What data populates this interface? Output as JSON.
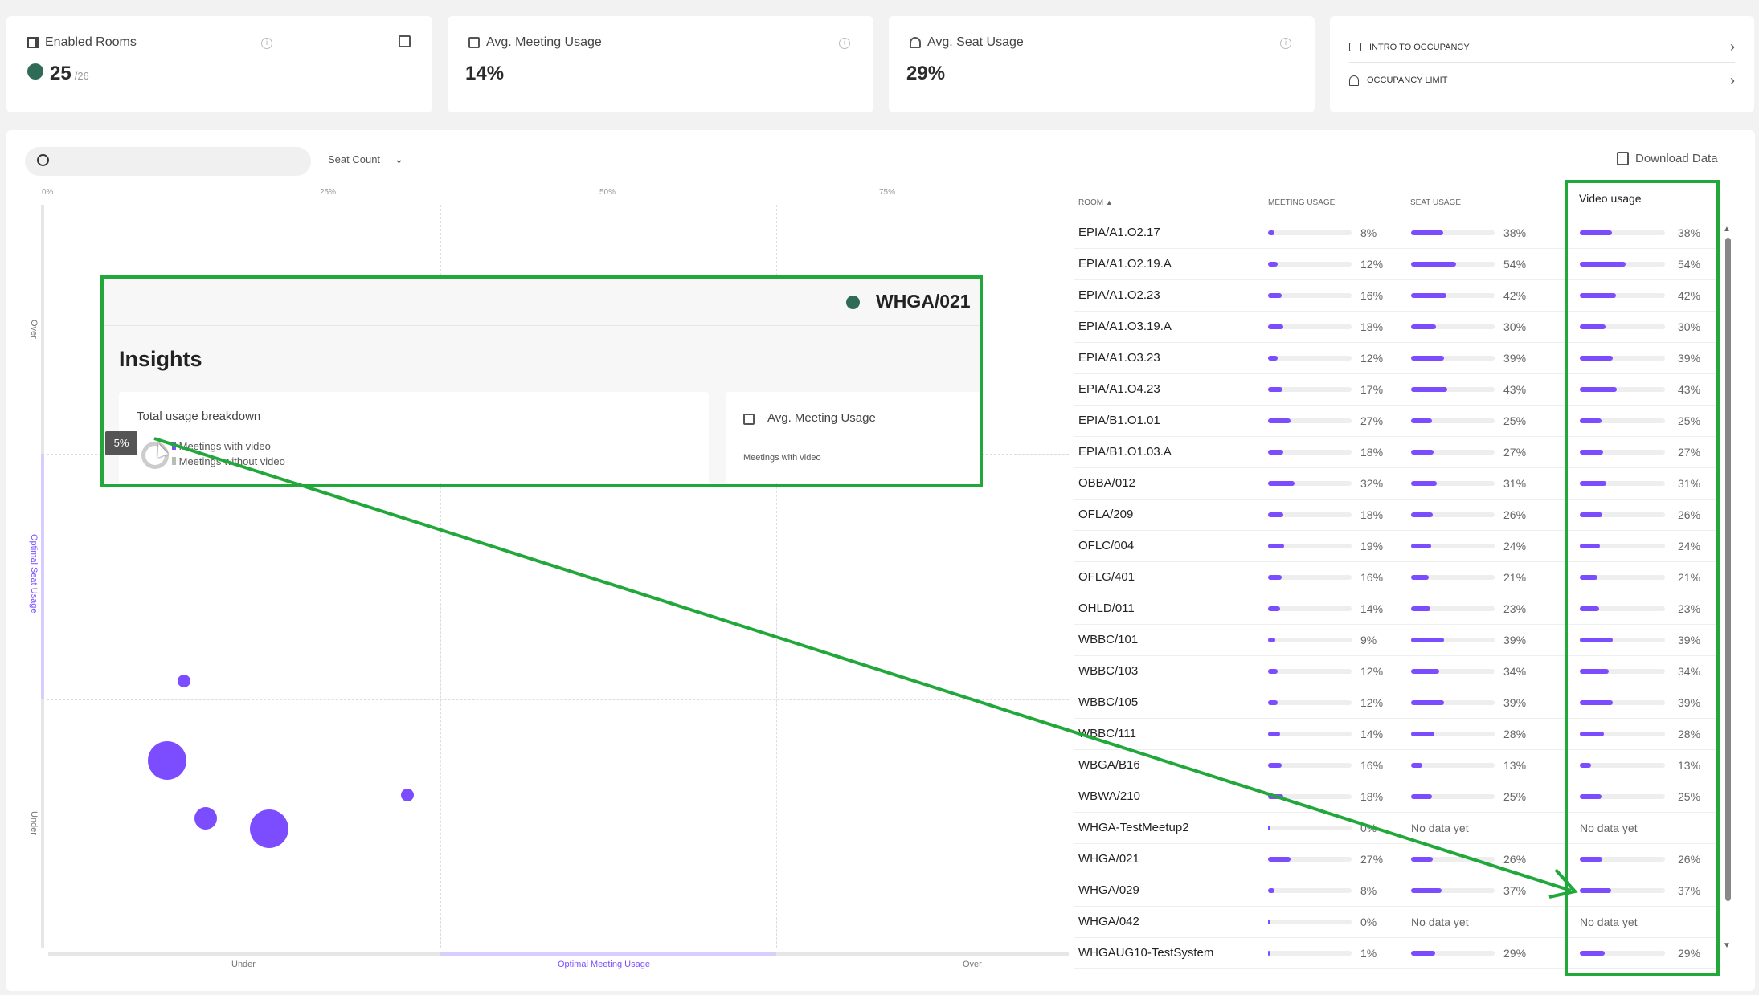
{
  "kpis": {
    "enabled_rooms": {
      "label": "Enabled Rooms",
      "value": "25",
      "sub": "/26"
    },
    "avg_meeting_usage": {
      "label": "Avg. Meeting Usage",
      "value": "14%"
    },
    "avg_seat_usage": {
      "label": "Avg. Seat Usage",
      "value": "29%"
    },
    "links": [
      {
        "label": "INTRO TO OCCUPANCY"
      },
      {
        "label": "OCCUPANCY LIMIT"
      }
    ]
  },
  "toolbar": {
    "search_placeholder": "",
    "seat_count_label": "Seat Count",
    "download_label": "Download Data"
  },
  "chart": {
    "x_ticks": [
      "0%",
      "25%",
      "50%",
      "75%"
    ],
    "y_axis_labels": {
      "over": "Over",
      "optimal": "Optimal Seat Usage",
      "under": "Under"
    },
    "x_axis_labels": {
      "under": "Under",
      "optimal": "Optimal Meeting Usage",
      "over": "Over"
    }
  },
  "insights": {
    "room_name": "WHGA/021",
    "title": "Insights",
    "breakdown_title": "Total usage breakdown",
    "tooltip": "5%",
    "legend_with_video": "Meetings with video",
    "legend_without_video": "Meetings without video",
    "avg_meeting_label": "Avg. Meeting Usage",
    "avg_meeting_sub": "Meetings with video"
  },
  "table": {
    "headers": {
      "room": "ROOM",
      "meeting": "MEETING USAGE",
      "seat": "SEAT USAGE",
      "video": "Video usage"
    },
    "no_data": "No data yet",
    "rows": [
      {
        "room": "EPIA/A1.O2.17",
        "meeting": 8,
        "seat": 38,
        "video": 38
      },
      {
        "room": "EPIA/A1.O2.19.A",
        "meeting": 12,
        "seat": 54,
        "video": 54
      },
      {
        "room": "EPIA/A1.O2.23",
        "meeting": 16,
        "seat": 42,
        "video": 42
      },
      {
        "room": "EPIA/A1.O3.19.A",
        "meeting": 18,
        "seat": 30,
        "video": 30
      },
      {
        "room": "EPIA/A1.O3.23",
        "meeting": 12,
        "seat": 39,
        "video": 39
      },
      {
        "room": "EPIA/A1.O4.23",
        "meeting": 17,
        "seat": 43,
        "video": 43
      },
      {
        "room": "EPIA/B1.O1.01",
        "meeting": 27,
        "seat": 25,
        "video": 25
      },
      {
        "room": "EPIA/B1.O1.03.A",
        "meeting": 18,
        "seat": 27,
        "video": 27
      },
      {
        "room": "OBBA/012",
        "meeting": 32,
        "seat": 31,
        "video": 31
      },
      {
        "room": "OFLA/209",
        "meeting": 18,
        "seat": 26,
        "video": 26
      },
      {
        "room": "OFLC/004",
        "meeting": 19,
        "seat": 24,
        "video": 24
      },
      {
        "room": "OFLG/401",
        "meeting": 16,
        "seat": 21,
        "video": 21
      },
      {
        "room": "OHLD/011",
        "meeting": 14,
        "seat": 23,
        "video": 23
      },
      {
        "room": "WBBC/101",
        "meeting": 9,
        "seat": 39,
        "video": 39
      },
      {
        "room": "WBBC/103",
        "meeting": 12,
        "seat": 34,
        "video": 34
      },
      {
        "room": "WBBC/105",
        "meeting": 12,
        "seat": 39,
        "video": 39
      },
      {
        "room": "WBBC/111",
        "meeting": 14,
        "seat": 28,
        "video": 28
      },
      {
        "room": "WBGA/B16",
        "meeting": 16,
        "seat": 13,
        "video": 13
      },
      {
        "room": "WBWA/210",
        "meeting": 18,
        "seat": 25,
        "video": 25
      },
      {
        "room": "WHGA-TestMeetup2",
        "meeting": 0,
        "seat": null,
        "video": null
      },
      {
        "room": "WHGA/021",
        "meeting": 27,
        "seat": 26,
        "video": 26
      },
      {
        "room": "WHGA/029",
        "meeting": 8,
        "seat": 37,
        "video": 37
      },
      {
        "room": "WHGA/042",
        "meeting": 0,
        "seat": null,
        "video": null
      },
      {
        "room": "WHGAUG10-TestSystem",
        "meeting": 1,
        "seat": 29,
        "video": 29
      }
    ]
  },
  "colors": {
    "accent": "#7c4dff",
    "highlight": "#22a83a",
    "status_dot": "#2f6b57"
  }
}
